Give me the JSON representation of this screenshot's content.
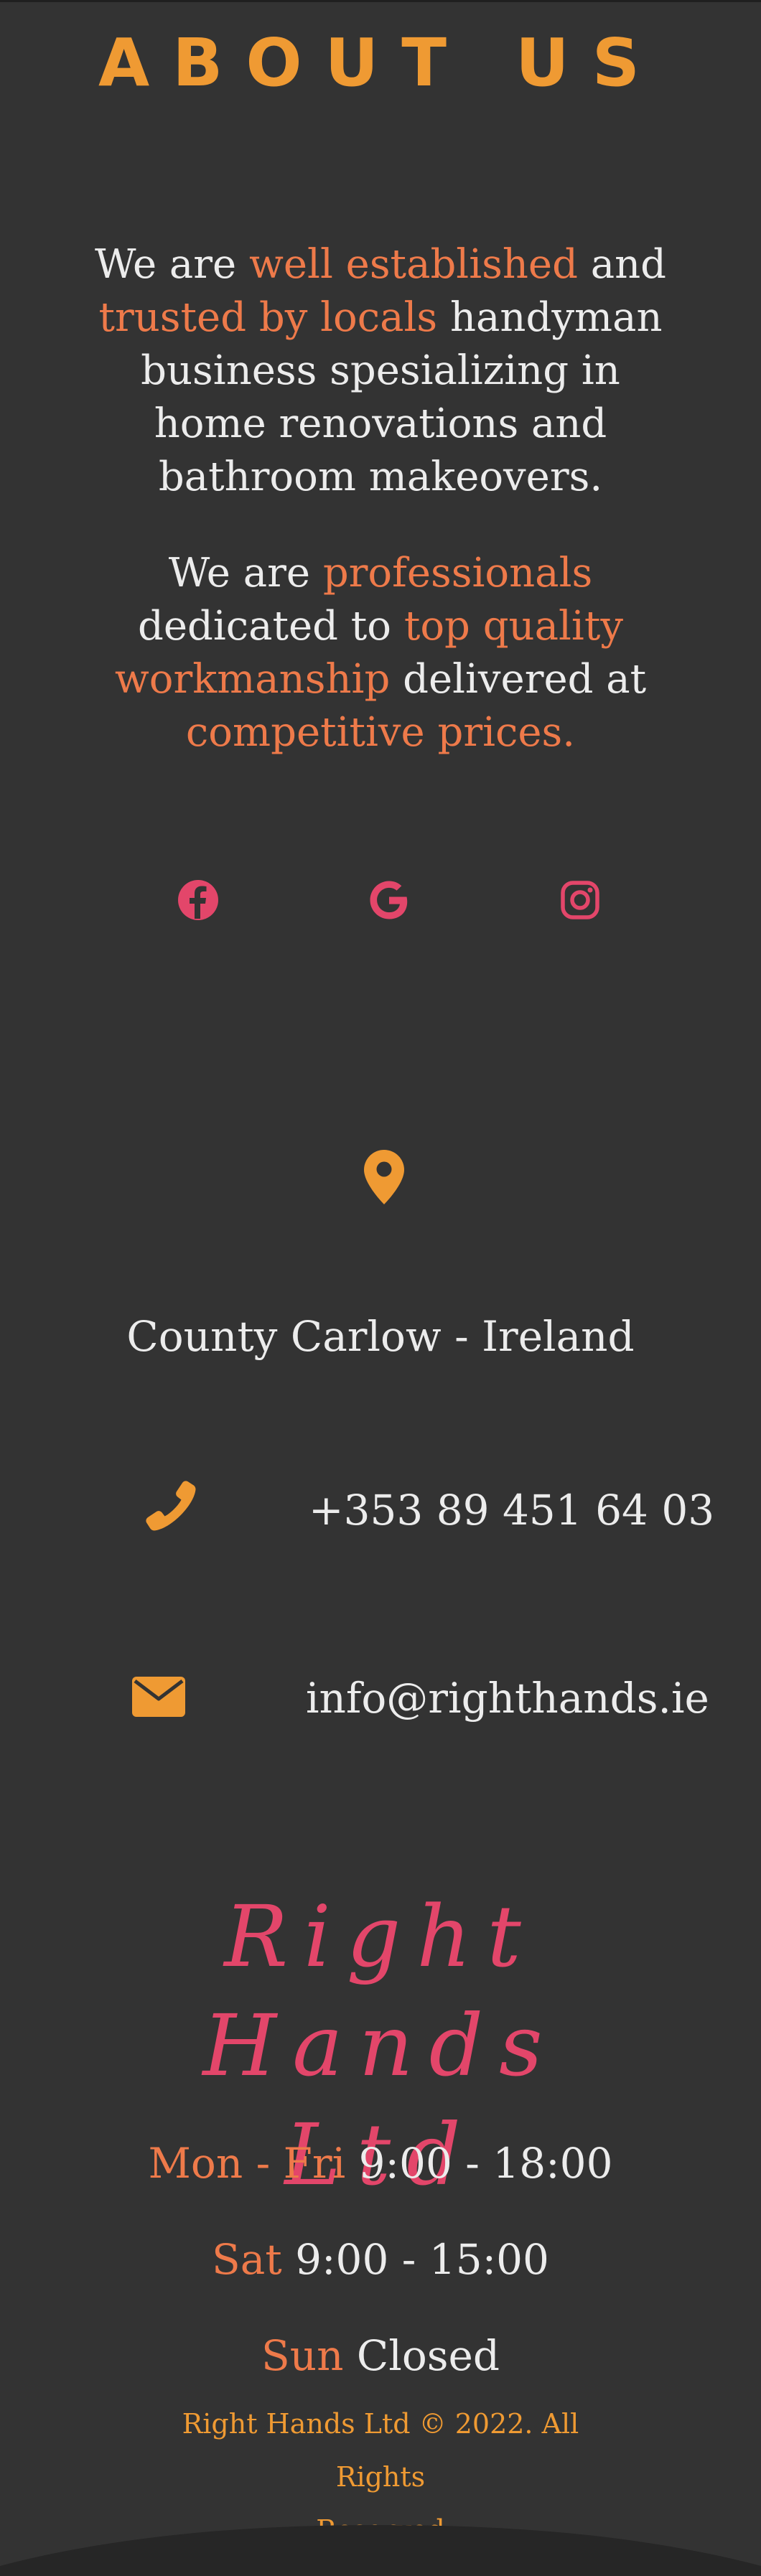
{
  "heading": "ABOUT US",
  "about": {
    "p1": {
      "t1": "We are ",
      "h1": "well established",
      "t2": " and ",
      "h2": "trusted by locals",
      "t3": " handyman business spesializing in home renovations and bathroom makeovers."
    },
    "p2": {
      "t1": "We are ",
      "h1": "professionals",
      "t2": " dedicated to ",
      "h2": "top quality workmanship",
      "t3": " delivered at ",
      "h3": "competitive prices."
    }
  },
  "social": {
    "icons": [
      "facebook-icon",
      "google-icon",
      "instagram-icon"
    ],
    "color": "#e3466a"
  },
  "contact": {
    "address": "County Carlow - Ireland",
    "phone": "+353 89 451 64 03",
    "email": "info@righthands.ie",
    "icon_color": "#ef9a33"
  },
  "brand": {
    "line1": "Right Hands",
    "line2": "Ltd"
  },
  "hours": [
    {
      "day": "Mon - Fri",
      "time": "9:00 - 18:00"
    },
    {
      "day": "Sat",
      "time": "9:00 - 15:00"
    },
    {
      "day": "Sun",
      "time": "Closed"
    }
  ],
  "footer": {
    "line1": "Right Hands Ltd © 2022. All Rights",
    "line2": "Reserved"
  },
  "colors": {
    "background": "#333333",
    "heading": "#ef9a33",
    "highlight": "#ee7a4a",
    "brand": "#e3466a",
    "text": "#ececec"
  }
}
